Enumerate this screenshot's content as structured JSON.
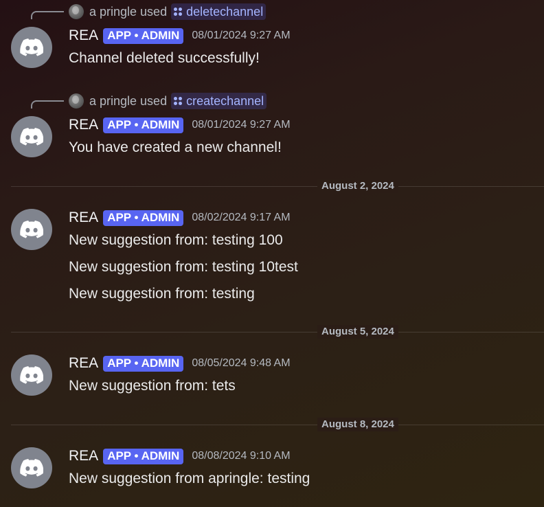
{
  "messages": [
    {
      "reply": {
        "user": "a pringle",
        "used_text": "used",
        "command": "deletechannel"
      },
      "author": "REA",
      "badge": "APP • ADMIN",
      "timestamp": "08/01/2024 9:27 AM",
      "lines": [
        "Channel deleted successfully!"
      ]
    },
    {
      "reply": {
        "user": "a pringle",
        "used_text": "used",
        "command": "createchannel"
      },
      "author": "REA",
      "badge": "APP • ADMIN",
      "timestamp": "08/01/2024 9:27 AM",
      "lines": [
        "You have created a new channel!"
      ]
    },
    {
      "author": "REA",
      "badge": "APP • ADMIN",
      "timestamp": "08/02/2024 9:17 AM",
      "lines": [
        "New suggestion from: testing 100",
        "New suggestion from: testing 10test",
        "New suggestion from: testing"
      ]
    },
    {
      "author": "REA",
      "badge": "APP • ADMIN",
      "timestamp": "08/05/2024 9:48 AM",
      "lines": [
        "New suggestion from: tets"
      ]
    },
    {
      "author": "REA",
      "badge": "APP • ADMIN",
      "timestamp": "08/08/2024 9:10 AM",
      "lines": [
        "New suggestion from apringle: testing"
      ]
    }
  ],
  "dividers": [
    "August 2, 2024",
    "August 5, 2024",
    "August 8, 2024"
  ],
  "icons": {
    "avatar": "discord-logo-icon",
    "command": "slash-command-icon",
    "reply_avatar": "user-avatar"
  },
  "colors": {
    "badge": "#5865f2",
    "avatar_bg": "#80848e",
    "command_text": "#a4b4ff"
  }
}
